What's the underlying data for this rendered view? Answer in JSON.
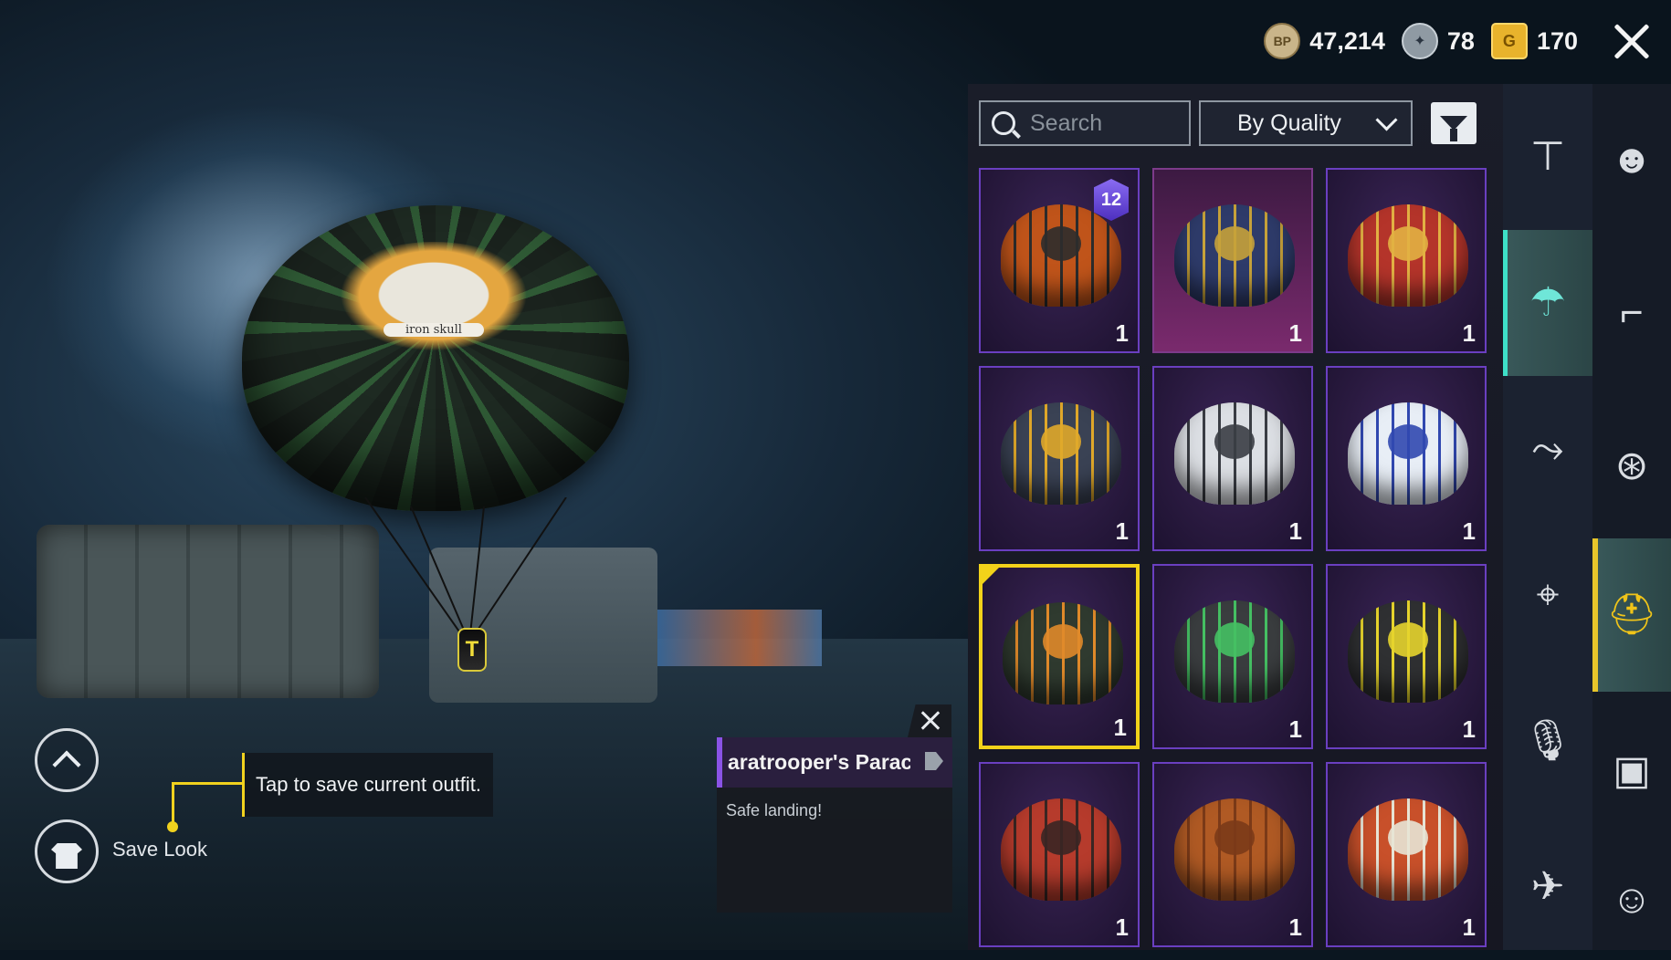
{
  "currency": {
    "bp_icon": "BP",
    "bp_value": "47,214",
    "ag_value": "78",
    "g_icon": "G",
    "g_value": "170"
  },
  "toolbar": {
    "search_placeholder": "Search",
    "sort_value": "By Quality"
  },
  "preview": {
    "chute_text": "iron skull",
    "rider_badge": "T"
  },
  "items": [
    {
      "qty": "1",
      "badge": "12",
      "colors": [
        "#c0541a",
        "#2c2c2c"
      ]
    },
    {
      "qty": "1",
      "colors": [
        "#2e3b6a",
        "#c7a23a"
      ]
    },
    {
      "qty": "1",
      "colors": [
        "#b4342a",
        "#e2b143"
      ]
    },
    {
      "qty": "1",
      "colors": [
        "#3a4254",
        "#e0a82a"
      ]
    },
    {
      "qty": "1",
      "colors": [
        "#dcdfe4",
        "#3a3d44"
      ]
    },
    {
      "qty": "1",
      "colors": [
        "#e8eef6",
        "#3148b0"
      ]
    },
    {
      "qty": "1",
      "colors": [
        "#2f3a2f",
        "#e08a2a"
      ]
    },
    {
      "qty": "1",
      "colors": [
        "#3a3d3f",
        "#45c063"
      ]
    },
    {
      "qty": "1",
      "colors": [
        "#2f3032",
        "#e6d42c"
      ]
    },
    {
      "qty": "1",
      "colors": [
        "#b63b2c",
        "#3a2623"
      ]
    },
    {
      "qty": "1",
      "colors": [
        "#b05a24",
        "#7b3a18"
      ]
    },
    {
      "qty": "1",
      "colors": [
        "#c8502a",
        "#e7e4d5"
      ]
    }
  ],
  "tooltip": {
    "text": "Tap to save current outfit."
  },
  "save_look": {
    "label": "Save Look"
  },
  "info": {
    "title": "aratrooper's Parachı",
    "description": "Safe landing!"
  },
  "colors": {
    "selected_border": "#f2d21a",
    "purple_border": "#6a3fc0",
    "active_tab_bar": "#e7c52a"
  }
}
